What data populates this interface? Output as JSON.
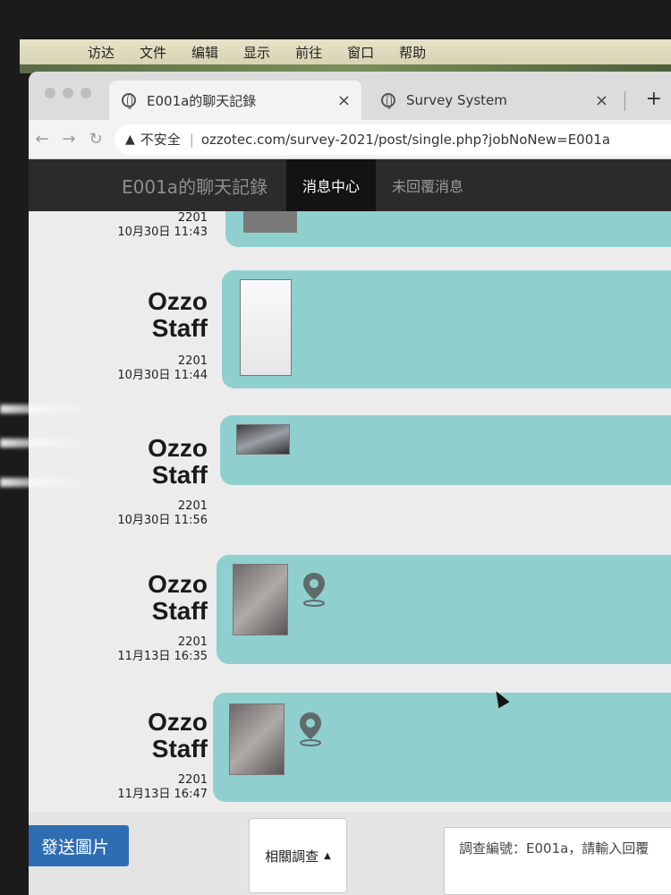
{
  "menubar": {
    "items": [
      "访达",
      "文件",
      "编辑",
      "显示",
      "前往",
      "窗口",
      "帮助"
    ]
  },
  "browser": {
    "tabs": [
      {
        "title": "E001a的聊天記錄"
      },
      {
        "title": "Survey System"
      }
    ],
    "security_label": "不安全",
    "url": "ozzotec.com/survey-2021/post/single.php?jobNoNew=E001a"
  },
  "site_nav": {
    "brand": "E001a的聊天記錄",
    "items": [
      {
        "label": "消息中心",
        "active": true
      },
      {
        "label": "未回覆消息",
        "active": false
      }
    ]
  },
  "messages": [
    {
      "sender": "",
      "id": "2201",
      "time": "10月30日 11:43"
    },
    {
      "sender_line1": "Ozzo",
      "sender_line2": "Staff",
      "id": "2201",
      "time": "10月30日 11:44"
    },
    {
      "sender_line1": "Ozzo",
      "sender_line2": "Staff",
      "id": "2201",
      "time": "10月30日 11:56"
    },
    {
      "sender_line1": "Ozzo",
      "sender_line2": "Staff",
      "id": "2201",
      "time": "11月13日 16:35"
    },
    {
      "sender_line1": "Ozzo",
      "sender_line2": "Staff",
      "id": "2201",
      "time": "11月13日 16:47"
    }
  ],
  "bottom": {
    "send_image": "發送圖片",
    "related": "相關調查",
    "reply_placeholder": "調查編號：E001a，請輸入回覆"
  },
  "colors": {
    "bubble": "#8fd0cf",
    "send_button": "#2f6db3",
    "nav_bg": "#2b2b2b"
  }
}
